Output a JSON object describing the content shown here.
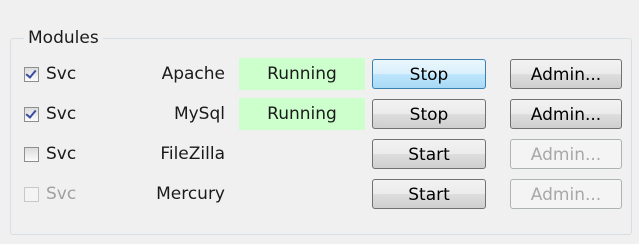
{
  "group": {
    "title": "Modules"
  },
  "modules": [
    {
      "svc_label": "Svc",
      "svc_checked": true,
      "svc_enabled": true,
      "name": "Apache",
      "status": "Running",
      "action": "Stop",
      "action_focused": true,
      "admin": "Admin...",
      "admin_enabled": true
    },
    {
      "svc_label": "Svc",
      "svc_checked": true,
      "svc_enabled": true,
      "name": "MySql",
      "status": "Running",
      "action": "Stop",
      "action_focused": false,
      "admin": "Admin...",
      "admin_enabled": true
    },
    {
      "svc_label": "Svc",
      "svc_checked": false,
      "svc_enabled": true,
      "name": "FileZilla",
      "status": "",
      "action": "Start",
      "action_focused": false,
      "admin": "Admin...",
      "admin_enabled": false
    },
    {
      "svc_label": "Svc",
      "svc_checked": false,
      "svc_enabled": false,
      "name": "Mercury",
      "status": "",
      "action": "Start",
      "action_focused": false,
      "admin": "Admin...",
      "admin_enabled": false
    }
  ],
  "colors": {
    "status_running_bg": "#ccffcc",
    "focus_border": "#3c7fb1",
    "disabled_text": "#a8a8a8"
  }
}
